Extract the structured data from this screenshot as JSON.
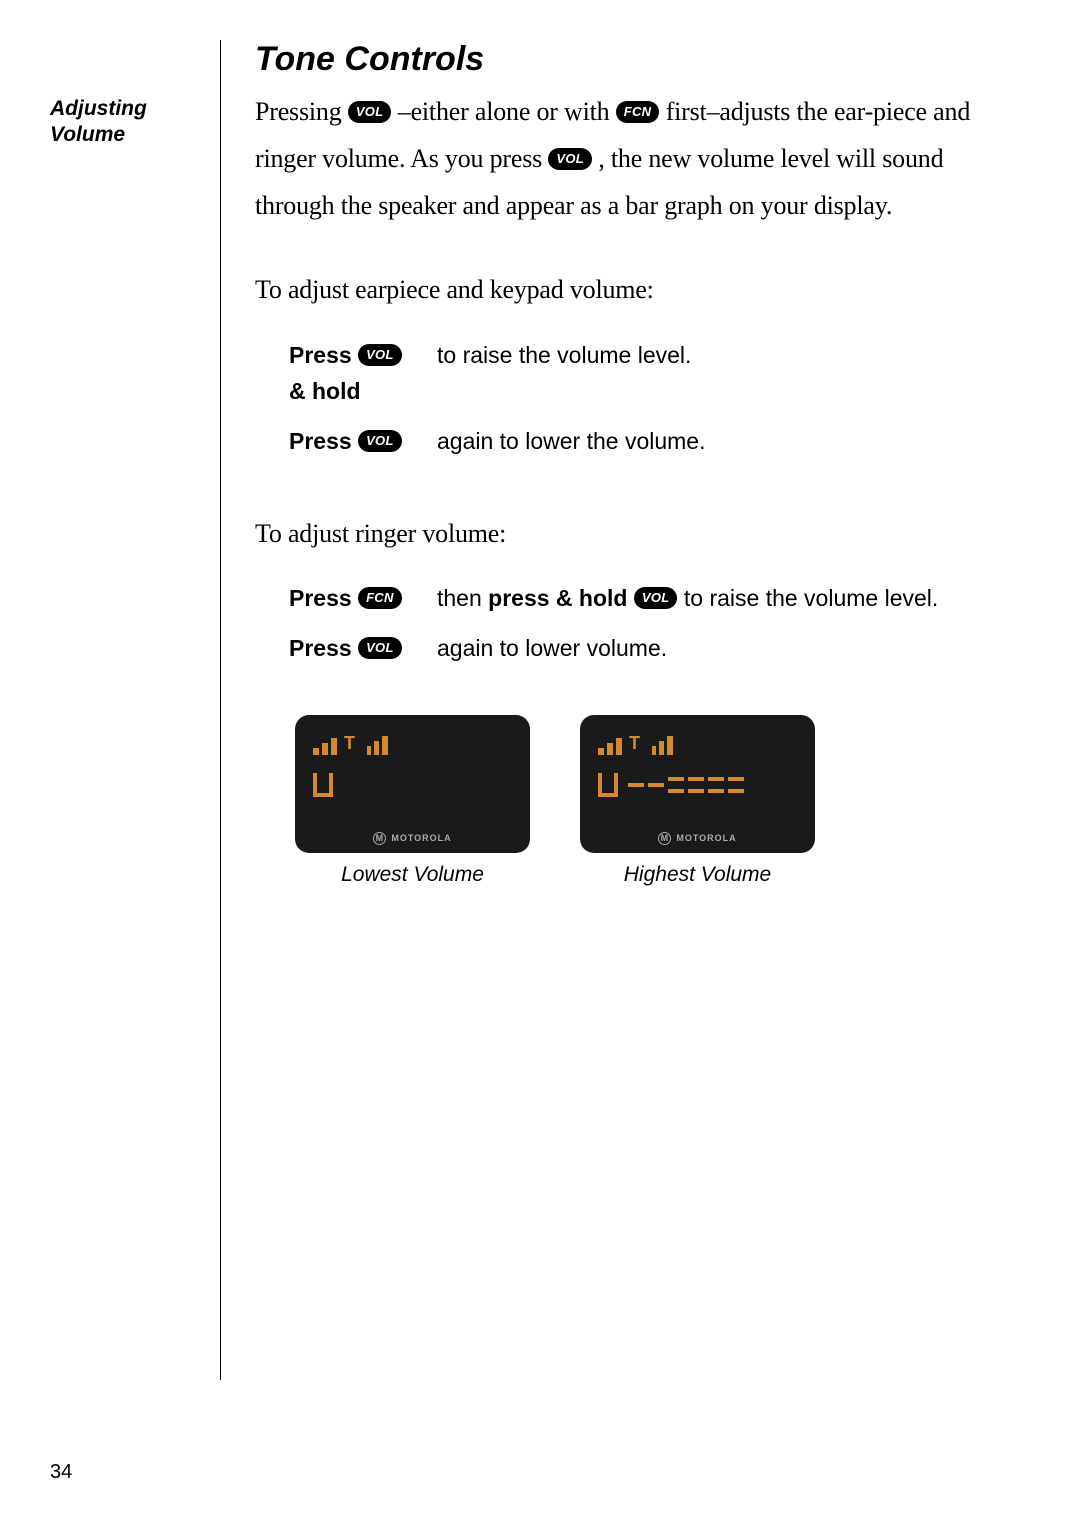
{
  "pageNumber": "34",
  "sidebar": {
    "heading": "Adjusting Volume"
  },
  "title": "Tone Controls",
  "buttons": {
    "vol": "VOL",
    "fcn": "FCN"
  },
  "intro": {
    "p1a": "Pressing ",
    "p1b": " –either alone or with ",
    "p1c": " first–adjusts the ear-piece and ringer volume. As you press ",
    "p1d": " , the new volume level will sound through the speaker and appear as a bar graph on your display."
  },
  "earpieceLead": "To adjust earpiece and keypad volume:",
  "earpiece": {
    "row1": {
      "press": "Press",
      "hold": "& hold",
      "right": " to raise the volume level."
    },
    "row2": {
      "press": "Press",
      "right": " again to lower the volume."
    }
  },
  "ringerLead": "To adjust ringer volume:",
  "ringer": {
    "row1": {
      "press": "Press",
      "then": " then ",
      "pressHold": "press & hold ",
      "tail": " to raise the volume level."
    },
    "row2": {
      "press": "Press",
      "right": " again to lower volume."
    }
  },
  "display": {
    "motorola": "MOTOROLA",
    "motoM": "M",
    "lowCaption": "Lowest Volume",
    "highCaption": "Highest Volume"
  }
}
